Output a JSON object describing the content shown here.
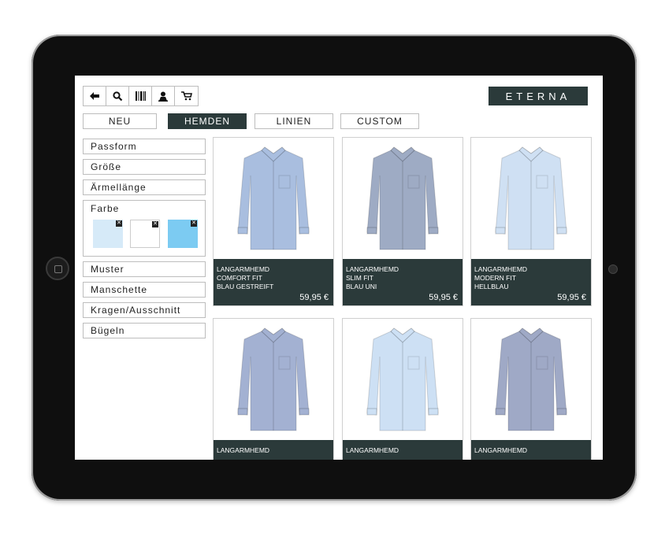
{
  "toolbar": {
    "icons": [
      "back-arrow-icon",
      "search-icon",
      "barcode-icon",
      "user-icon",
      "cart-icon"
    ]
  },
  "brand": {
    "logo": "ETERNA"
  },
  "nav": {
    "tabs": [
      {
        "label": "NEU",
        "active": false
      },
      {
        "label": "HEMDEN",
        "active": true
      },
      {
        "label": "LINIEN",
        "active": false
      },
      {
        "label": "CUSTOM",
        "active": false
      }
    ]
  },
  "filters": {
    "passform": "Passform",
    "groesse": "Größe",
    "aermellaenge": "Ärmellänge",
    "farbe": {
      "label": "Farbe",
      "swatches": [
        "#d6eaf8",
        "#ffffff",
        "#7ccbf2"
      ],
      "remove_symbol": "✕"
    },
    "muster": "Muster",
    "manschette": "Manschette",
    "kragen": "Kragen/Ausschnitt",
    "buegeln": "Bügeln"
  },
  "products": [
    {
      "line1": "LANGARMHEMD",
      "line2": "COMFORT FIT",
      "line3": "BLAU GESTREIFT",
      "price": "59,95 €",
      "color": "#a9bedf"
    },
    {
      "line1": "LANGARMHEMD",
      "line2": "SLIM FIT",
      "line3": "BLAU UNI",
      "price": "59,95 €",
      "color": "#9eabc4"
    },
    {
      "line1": "LANGARMHEMD",
      "line2": "MODERN FIT",
      "line3": "HELLBLAU",
      "price": "59,95 €",
      "color": "#cfe0f3"
    },
    {
      "line1": "LANGARMHEMD",
      "color": "#a3b1d2"
    },
    {
      "line1": "LANGARMHEMD",
      "color": "#cde0f4"
    },
    {
      "line1": "LANGARMHEMD",
      "color": "#9fa9c6"
    }
  ],
  "colors": {
    "accent": "#2b3a3a",
    "border": "#bdbdbd"
  }
}
